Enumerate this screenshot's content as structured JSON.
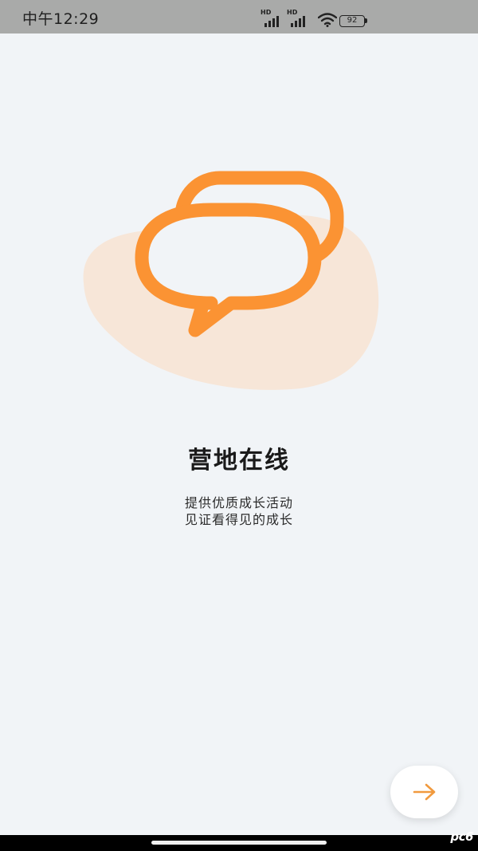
{
  "status_bar": {
    "time": "中午12:29",
    "signal_1_label": "HD",
    "signal_2_label": "HD",
    "battery": "92"
  },
  "illustration": {
    "icon": "chat-bubbles-icon",
    "accent_color": "#fb9333",
    "blob_color": "#f7e6d8"
  },
  "onboarding": {
    "title": "营地在线",
    "line_1": "提供优质成长活动",
    "line_2": "见证看得见的成长"
  },
  "next_button": {
    "icon": "arrow-right-icon",
    "color": "#f19a3e"
  },
  "watermark": "pc6"
}
